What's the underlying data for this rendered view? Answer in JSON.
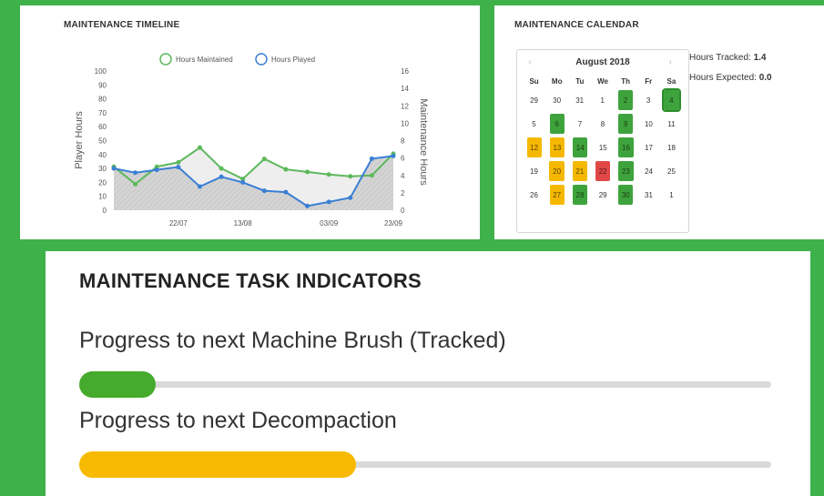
{
  "timeline": {
    "title": "MAINTENANCE TIMELINE",
    "chart_data": {
      "type": "line",
      "x": [
        "",
        "",
        "",
        "22/07",
        "",
        "",
        "13/08",
        "",
        "",
        "",
        "03/09",
        "",
        "",
        "23/09"
      ],
      "x_tick_labels": [
        "22/07",
        "13/08",
        "03/09",
        "23/09"
      ],
      "series": [
        {
          "name": "Hours Maintained",
          "axis": "right",
          "color": "#5cb85c",
          "values": [
            5.0,
            3.0,
            5.0,
            5.5,
            7.2,
            4.8,
            3.6,
            5.9,
            4.7,
            4.4,
            4.1,
            3.9,
            4.0,
            6.5
          ]
        },
        {
          "name": "Hours Played",
          "axis": "left",
          "color": "#3a7fd5",
          "values": [
            30,
            27,
            29,
            31,
            17,
            24,
            20,
            14,
            13,
            3,
            6,
            9,
            37,
            39
          ]
        }
      ],
      "ylabel": "Player Hours",
      "y2label": "Maintenance Hours",
      "ylim": [
        0,
        100
      ],
      "y2lim": [
        0,
        16
      ],
      "y_ticks": [
        "100",
        "90",
        "80",
        "70",
        "60",
        "50",
        "40",
        "30",
        "20",
        "10",
        "0"
      ],
      "y2_ticks": [
        "16",
        "14",
        "12",
        "10",
        "8",
        "6",
        "4",
        "2",
        "0"
      ],
      "legend": "top"
    }
  },
  "calendar": {
    "title": "MAINTENANCE CALENDAR",
    "month": "August 2018",
    "prev": "‹",
    "next": "›",
    "weekdays": [
      "Su",
      "Mo",
      "Tu",
      "We",
      "Th",
      "Fr",
      "Sa"
    ],
    "weeks": [
      [
        {
          "d": "29",
          "s": ""
        },
        {
          "d": "30",
          "s": ""
        },
        {
          "d": "31",
          "s": ""
        },
        {
          "d": "1",
          "s": ""
        },
        {
          "d": "2",
          "s": "green"
        },
        {
          "d": "3",
          "s": ""
        },
        {
          "d": "4",
          "s": "green-today"
        }
      ],
      [
        {
          "d": "5",
          "s": ""
        },
        {
          "d": "6",
          "s": "green"
        },
        {
          "d": "7",
          "s": ""
        },
        {
          "d": "8",
          "s": ""
        },
        {
          "d": "9",
          "s": "green"
        },
        {
          "d": "10",
          "s": ""
        },
        {
          "d": "11",
          "s": ""
        }
      ],
      [
        {
          "d": "12",
          "s": "yellow"
        },
        {
          "d": "13",
          "s": "yellow"
        },
        {
          "d": "14",
          "s": "green"
        },
        {
          "d": "15",
          "s": ""
        },
        {
          "d": "16",
          "s": "green"
        },
        {
          "d": "17",
          "s": ""
        },
        {
          "d": "18",
          "s": ""
        }
      ],
      [
        {
          "d": "19",
          "s": ""
        },
        {
          "d": "20",
          "s": "yellow"
        },
        {
          "d": "21",
          "s": "yellow"
        },
        {
          "d": "22",
          "s": "red"
        },
        {
          "d": "23",
          "s": "green"
        },
        {
          "d": "24",
          "s": ""
        },
        {
          "d": "25",
          "s": ""
        }
      ],
      [
        {
          "d": "26",
          "s": ""
        },
        {
          "d": "27",
          "s": "yellow"
        },
        {
          "d": "28",
          "s": "green"
        },
        {
          "d": "29",
          "s": ""
        },
        {
          "d": "30",
          "s": "green"
        },
        {
          "d": "31",
          "s": ""
        },
        {
          "d": "1",
          "s": ""
        }
      ]
    ],
    "hours_tracked_label": "Hours Tracked:",
    "hours_tracked_value": "1.4",
    "hours_expected_label": "Hours Expected:",
    "hours_expected_value": "0.0"
  },
  "indicators": {
    "title": "MAINTENANCE TASK INDICATORS",
    "items": [
      {
        "label": "Progress to next Machine Brush (Tracked)",
        "progress": 0.11,
        "color": "#46aa2c"
      },
      {
        "label": "Progress to next Decompaction",
        "progress": 0.4,
        "color": "#f7ba00"
      }
    ]
  },
  "colors": {
    "background": "#3fb14a",
    "green": "#3ea33c",
    "yellow": "#f5b800",
    "red": "#e04848"
  }
}
